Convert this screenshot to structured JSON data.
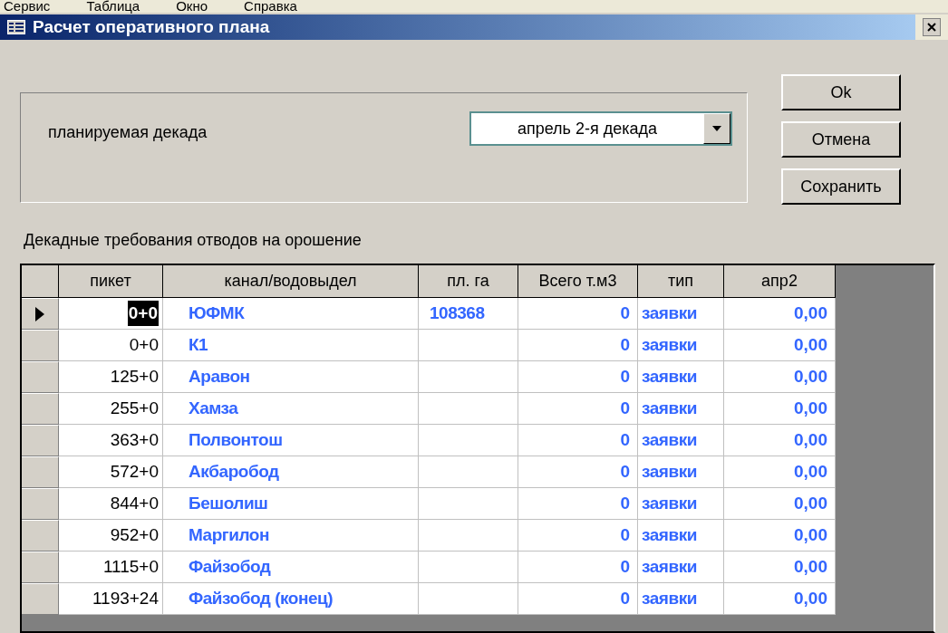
{
  "menu": [
    "Сервис",
    "Таблица",
    "Окно",
    "Справка"
  ],
  "window": {
    "title": "Расчет оперативного плана"
  },
  "decade": {
    "label": "планируемая декада",
    "value": "апрель 2-я декада"
  },
  "buttons": [
    "Ok",
    "Отмена",
    "Сохранить"
  ],
  "table_title": "Декадные требования отводов на орошение",
  "table": {
    "columns": [
      "пикет",
      "канал/водовыдел",
      "пл. га",
      "Всего т.м3",
      "тип",
      "апр2"
    ],
    "rows": [
      {
        "selected": true,
        "cells": [
          "0+0",
          "ЮФМК",
          "108368",
          "0",
          "заявки",
          "0,00"
        ]
      },
      {
        "selected": false,
        "cells": [
          "0+0",
          "К1",
          null,
          "0",
          "заявки",
          "0,00"
        ]
      },
      {
        "selected": false,
        "cells": [
          "125+0",
          "Аравон",
          null,
          "0",
          "заявки",
          "0,00"
        ]
      },
      {
        "selected": false,
        "cells": [
          "255+0",
          "Хамза",
          null,
          "0",
          "заявки",
          "0,00"
        ]
      },
      {
        "selected": false,
        "cells": [
          "363+0",
          "Полвонтош",
          null,
          "0",
          "заявки",
          "0,00"
        ]
      },
      {
        "selected": false,
        "cells": [
          "572+0",
          "Акбаробод",
          null,
          "0",
          "заявки",
          "0,00"
        ]
      },
      {
        "selected": false,
        "cells": [
          "844+0",
          "Бешолиш",
          null,
          "0",
          "заявки",
          "0,00"
        ]
      },
      {
        "selected": false,
        "cells": [
          "952+0",
          "Маргилон",
          null,
          "0",
          "заявки",
          "0,00"
        ]
      },
      {
        "selected": false,
        "cells": [
          "1115+0",
          "Файзобод",
          null,
          "0",
          "заявки",
          "0,00"
        ]
      },
      {
        "selected": false,
        "cells": [
          "1193+24",
          "Файзобод (конец)",
          null,
          "0",
          "заявки",
          "0,00"
        ]
      }
    ]
  }
}
